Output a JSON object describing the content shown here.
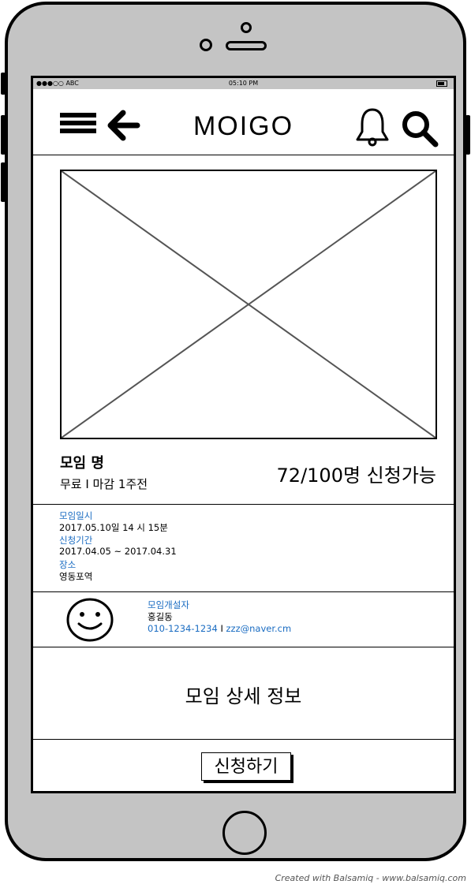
{
  "status_bar": {
    "carrier": "●●●○○ ABC",
    "time": "05:10 PM"
  },
  "header": {
    "app_title": "MOIGO"
  },
  "meeting": {
    "name": "모임 명",
    "subtitle": "무료 I 마감 1주전",
    "capacity": "72/100명 신청가능"
  },
  "info": {
    "date_label": "모임일시",
    "date_value": "2017.05.10일  14 시 15분",
    "apply_period_label": "신청기간",
    "apply_period_value": "2017.04.05 ~ 2017.04.31",
    "place_label": "장소",
    "place_value": "영동포역"
  },
  "host": {
    "label": "모임개설자",
    "name": "홍길동",
    "phone": "010-1234-1234",
    "separator": " I ",
    "email": "zzz@naver.cm"
  },
  "detail": {
    "text": "모임 상세 정보"
  },
  "actions": {
    "apply_label": "신청하기"
  },
  "footer": {
    "credit": "Created with Balsamiq - www.balsamiq.com"
  },
  "colors": {
    "link_blue": "#1a6cc2",
    "phone_gray": "#c4c4c4"
  },
  "icons": [
    "hamburger-menu-icon",
    "back-arrow-icon",
    "bell-icon",
    "search-icon",
    "smiley-avatar-icon",
    "battery-icon"
  ]
}
